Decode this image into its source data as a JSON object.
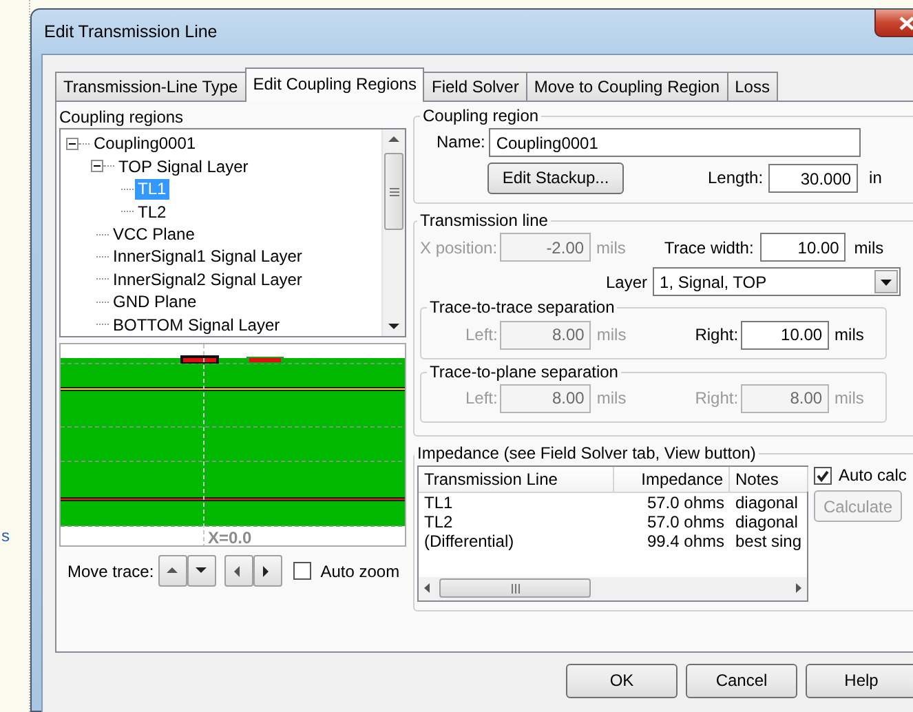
{
  "background": {
    "text": "s"
  },
  "window": {
    "title": "Edit Transmission Line"
  },
  "tabs": [
    {
      "label": "Transmission-Line Type",
      "selected": false
    },
    {
      "label": "Edit Coupling Regions",
      "selected": true
    },
    {
      "label": "Field Solver",
      "selected": false
    },
    {
      "label": "Move to Coupling Region",
      "selected": false
    },
    {
      "label": "Loss",
      "selected": false
    }
  ],
  "coupling_regions": {
    "label": "Coupling regions",
    "tree": [
      {
        "label": "Coupling0001",
        "expanded": true,
        "children": [
          {
            "label": "TOP Signal Layer",
            "expanded": true,
            "children": [
              {
                "label": "TL1",
                "selected": true
              },
              {
                "label": "TL2",
                "selected": false
              }
            ]
          },
          {
            "label": "VCC Plane"
          },
          {
            "label": "InnerSignal1 Signal Layer"
          },
          {
            "label": "InnerSignal2 Signal Layer"
          },
          {
            "label": "GND Plane"
          },
          {
            "label": "BOTTOM Signal Layer"
          }
        ]
      }
    ]
  },
  "cross_section": {
    "x_label": "X=0.0"
  },
  "move_trace": {
    "label": "Move trace:",
    "auto_zoom": {
      "label": "Auto zoom",
      "checked": false
    }
  },
  "coupling_region": {
    "title": "Coupling region",
    "name_label": "Name:",
    "name": "Coupling0001",
    "edit_stackup": "Edit Stackup...",
    "length_label": "Length:",
    "length": "30.000",
    "length_unit": "in"
  },
  "transmission_line": {
    "title": "Transmission line",
    "x_position": {
      "label": "X position:",
      "value": "-2.00",
      "unit": "mils",
      "disabled": true
    },
    "trace_width": {
      "label": "Trace width:",
      "value": "10.00",
      "unit": "mils",
      "disabled": false
    },
    "layer": {
      "label": "Layer",
      "value": "1, Signal, TOP"
    },
    "trace_to_trace": {
      "title": "Trace-to-trace separation",
      "left": {
        "label": "Left:",
        "value": "8.00",
        "unit": "mils",
        "disabled": true
      },
      "right": {
        "label": "Right:",
        "value": "10.00",
        "unit": "mils",
        "disabled": false
      }
    },
    "trace_to_plane": {
      "title": "Trace-to-plane separation",
      "left": {
        "label": "Left:",
        "value": "8.00",
        "unit": "mils",
        "disabled": true
      },
      "right": {
        "label": "Right:",
        "value": "8.00",
        "unit": "mils",
        "disabled": true
      }
    }
  },
  "impedance": {
    "title": "Impedance (see Field Solver tab, View button)",
    "columns": [
      "Transmission Line",
      "Impedance",
      "Notes"
    ],
    "rows": [
      [
        "TL1",
        "57.0 ohms",
        "diagonal"
      ],
      [
        "TL2",
        "57.0 ohms",
        "diagonal"
      ],
      [
        "(Differential)",
        "99.4 ohms",
        "best sing"
      ]
    ],
    "auto_calc": {
      "label": "Auto calc",
      "checked": true
    },
    "calculate": {
      "label": "Calculate",
      "disabled": true
    }
  },
  "buttons": [
    {
      "label": "OK"
    },
    {
      "label": "Cancel"
    },
    {
      "label": "Help"
    }
  ]
}
